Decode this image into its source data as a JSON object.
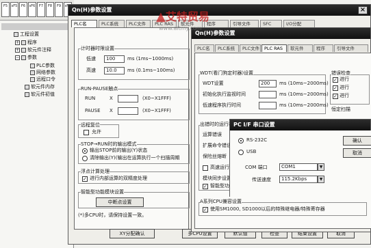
{
  "toolbar": {
    "icons": [
      "ladder-icon-1",
      "ladder-icon-2",
      "ladder-icon-3",
      "ladder-icon-4",
      "ladder-icon-5",
      "ladder-icon-6",
      "ladder-icon-7",
      "ladder-icon-8"
    ],
    "labels": [
      "F5",
      "sF5",
      "F6",
      "sF6",
      "F7",
      "F8",
      "F9",
      "sF9"
    ]
  },
  "tree": {
    "root": "工程",
    "items": [
      "工程",
      "程序",
      "软元件注释",
      "参数",
      "PLC参数",
      "网络参数",
      "远程口令",
      "软元件内存",
      "软元件初值"
    ]
  },
  "dlg1": {
    "title": "Qn(H)参数设置",
    "tabs": [
      "PLC名",
      "PLC系统",
      "PLC文件",
      "PLC RAS",
      "软元件",
      "程序",
      "引导文件",
      "SFC",
      "I/O分配"
    ],
    "timer_group": "计时器时限设置",
    "low_label": "低速",
    "low_value": "100",
    "low_unit": "ms (1ms~1000ms)",
    "high_label": "高速",
    "high_value": "10.0",
    "high_unit": "ms (0.1ms~100ms)",
    "runpause_group": "RUN-PAUSE触点",
    "run_label": "RUN",
    "run_x": "X",
    "run_range": "(X0~X1FFF)",
    "pause_label": "PAUSE",
    "pause_x": "X",
    "pause_range": "(X0~X1FFF)",
    "remote_reset": "远程复位",
    "allow": "允许",
    "stop_run_group": "STOP→RUN时的输出模式",
    "out_opt1": "输出STOP前的输出(Y)状态",
    "out_opt2": "清除输出(Y)(输出在运算执行一个扫描周期",
    "float_group": "浮点计算处理",
    "float_opt": "进行内部运算的双精度处理",
    "intel_group": "智能型功能模块设置",
    "interrupt_btn": "中断点设置",
    "note": "(*)多CPU时，请保持设置一致。",
    "bottom_buttons": [
      "XY分配确认",
      "多CPU设置",
      "默认值",
      "检查",
      "结束设置",
      "取消"
    ]
  },
  "dlg2": {
    "title": "Qn(H)参数设置",
    "tabs": [
      "PLC名",
      "PLC系统",
      "PLC文件",
      "PLC RAS",
      "软元件",
      "程序",
      "引导文件"
    ],
    "wdt_group": "WDT(看门狗定时器)设置",
    "wdt_label": "WDT设置",
    "wdt_value": "200",
    "wdt_unit": "ms (10ms~2000ms)",
    "init_scan": "初始化执行监视时间",
    "init_unit": "ms (10ms~2000ms)",
    "low_scan": "低速程序执行时间",
    "low_unit": "ms (10ms~2000ms)",
    "err_group": "错误检查",
    "err_items": [
      "进行",
      "进行",
      "进行"
    ],
    "const_scan": "恒定扫描",
    "err_run_group": "出错时的运行模式",
    "op_error": "运算错误",
    "ext_error": "扩展命令错误",
    "fuse_error": "保险丝熔断",
    "io_verify": "模块校验错误",
    "intel_err": "智能型功能模块错误",
    "high_speed_run": "高速运行",
    "module_sync": "模块同步设置",
    "sync_opt": "智能型功能模块",
    "a_series_group": "A系列CPU兼容设置",
    "a_series_opt": "使用SM1000, SD1000以后的特殊继电器/特殊寄存器"
  },
  "dlg3": {
    "title": "PC  I/F  串口设置",
    "rs232": "RS-232C",
    "usb": "USB",
    "com_label": "COM 端口",
    "com_value": "COM1",
    "speed_label": "传送速度",
    "speed_value": "115.2Kbps",
    "ok": "确认",
    "cancel": "取消"
  },
  "watermark": {
    "brand": "艾特贸易",
    "url": "www.aitmy.com"
  }
}
